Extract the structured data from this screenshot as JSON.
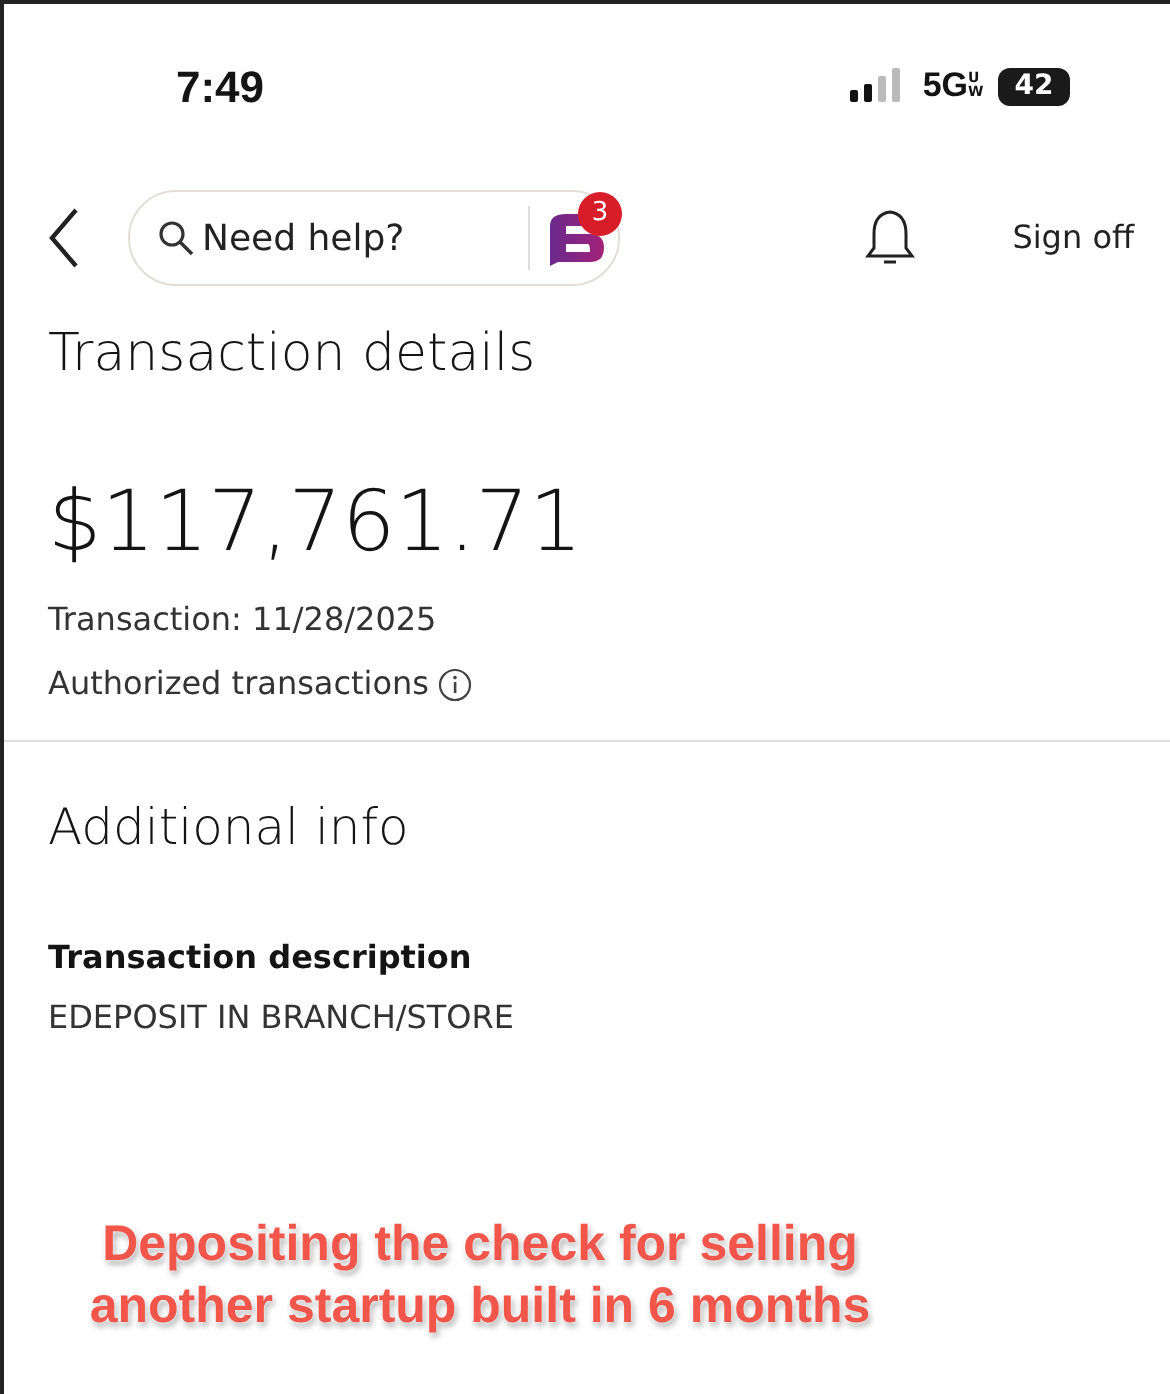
{
  "status_bar": {
    "time": "7:49",
    "network": "5G",
    "network_sub": "UW",
    "battery": "42"
  },
  "header": {
    "search": {
      "placeholder": "Need help?"
    },
    "chat_badge": "3",
    "sign_off": "Sign off"
  },
  "title": "Transaction details",
  "amount": "$117,761.71",
  "transaction_date": "Transaction: 11/28/2025",
  "authorized": "Authorized transactions",
  "additional": {
    "heading": "Additional info",
    "label": "Transaction description",
    "value": "EDEPOSIT IN BRANCH/STORE"
  },
  "caption": "Depositing the check for selling another startup built in 6 months"
}
